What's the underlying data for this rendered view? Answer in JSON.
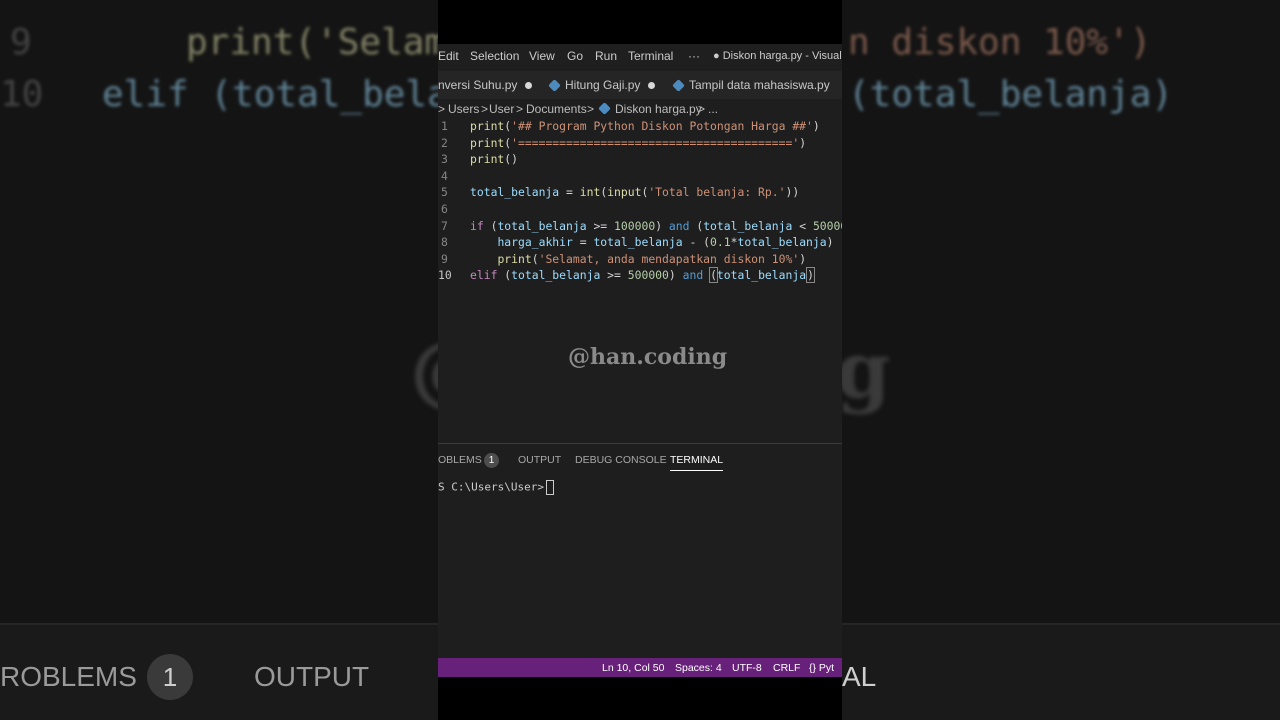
{
  "background": {
    "lines": [
      {
        "num": "9",
        "code": "print('Selam"
      },
      {
        "num": "10",
        "code": "elif (total_bela"
      }
    ],
    "right_lines": [
      {
        "code": "n diskon 10%')"
      },
      {
        "code": "(total_belanja)"
      }
    ],
    "bottom_tabs": {
      "problems": "ROBLEMS",
      "badge": "1",
      "output": "OUTPUT",
      "right": "AL"
    },
    "watermark_left": "@",
    "watermark_right": "g"
  },
  "menubar": {
    "items": [
      "Edit",
      "Selection",
      "View",
      "Go",
      "Run",
      "Terminal",
      "···"
    ],
    "title": "● Diskon harga.py - Visual S"
  },
  "tabs": [
    {
      "label": "nversi Suhu.py",
      "modified": true
    },
    {
      "label": "Hitung Gaji.py",
      "modified": true
    },
    {
      "label": "Tampil data mahasiswa.py",
      "modified": false
    }
  ],
  "breadcrumb": [
    "Users",
    ">",
    "User",
    ">",
    "Documents",
    ">",
    "Diskon harga.py",
    ">",
    "..."
  ],
  "editor": {
    "line_numbers": [
      "1",
      "2",
      "3",
      "4",
      "5",
      "6",
      "7",
      "8",
      "9",
      "10"
    ],
    "active_line": "10"
  },
  "watermark": "@han.coding",
  "panel": {
    "tabs": {
      "problems": "OBLEMS",
      "problems_count": "1",
      "output": "OUTPUT",
      "debug": "DEBUG CONSOLE",
      "terminal": "TERMINAL"
    },
    "prompt": "S C:\\Users\\User>"
  },
  "statusbar": {
    "position": "Ln 10, Col 50",
    "spaces": "Spaces: 4",
    "encoding": "UTF-8",
    "eol": "CRLF",
    "language": "{} Pyt"
  },
  "colors": {
    "statusbar": "#68217a",
    "editor_bg": "#1e1e1e",
    "string": "#ce9178",
    "function": "#dcdcaa",
    "keyword": "#c586c0"
  }
}
